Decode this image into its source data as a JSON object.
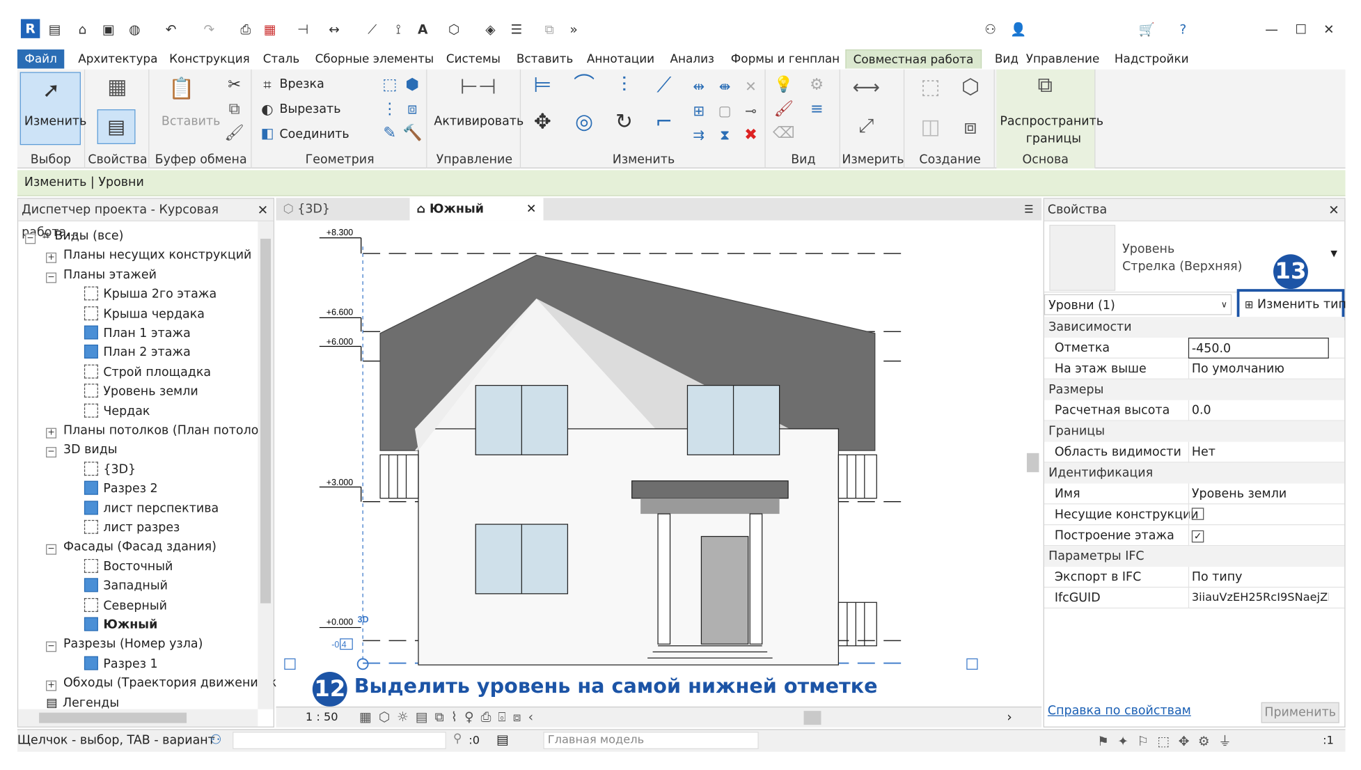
{
  "qat": {
    "app_icon": "R",
    "icons": [
      "file-icon",
      "open-icon",
      "save-icon",
      "sync-icon",
      "undo-icon",
      "redo-icon",
      "print-icon",
      "pdf-icon",
      "align-icon",
      "dimension-icon",
      "measure-icon",
      "tag-icon",
      "text-icon",
      "3d-view-icon",
      "section-icon",
      "thin-lines-icon",
      "close-hidden-icon",
      "switch-windows-icon"
    ],
    "right_icons": [
      "binoculars-icon",
      "user-icon",
      "cart-icon",
      "help-icon"
    ]
  },
  "menu": {
    "tabs": [
      "Файл",
      "Архитектура",
      "Конструкция",
      "Сталь",
      "Сборные элементы",
      "Системы",
      "Вставить",
      "Аннотации",
      "Анализ",
      "Формы и генплан",
      "Совместная работа",
      "Вид",
      "Управление",
      "Надстройки"
    ]
  },
  "ribbon": {
    "modify_label": "Изменить",
    "paste_label": "Вставить",
    "cut_label": "Врезка",
    "cut_out_label": "Вырезать",
    "join_label": "Соединить",
    "activate_label": "Активировать",
    "propagate_label1": "Распространить",
    "propagate_label2": "границы",
    "panels": {
      "select": "Выбор",
      "properties": "Свойства",
      "clipboard": "Буфер обмена",
      "geometry": "Геометрия",
      "control": "Управление",
      "modify": "Изменить",
      "view": "Вид",
      "measure": "Измерить",
      "create": "Создание",
      "basis": "Основа"
    }
  },
  "context_bar": "Изменить | Уровни",
  "project_browser": {
    "title": "Диспетчер проекта - Курсовая работа...",
    "items": [
      {
        "label": "Виды (все)",
        "level": 0,
        "toggle": "−",
        "icon": "views"
      },
      {
        "label": "Планы несущих конструкций",
        "level": 1,
        "toggle": "+"
      },
      {
        "label": "Планы этажей",
        "level": 1,
        "toggle": "−"
      },
      {
        "label": "Крыша 2го этажа",
        "level": 2,
        "icon": "plain"
      },
      {
        "label": "Крыша чердака",
        "level": 2,
        "icon": "plain"
      },
      {
        "label": "План 1 этажа",
        "level": 2,
        "icon": "blue"
      },
      {
        "label": "План 2 этажа",
        "level": 2,
        "icon": "blue"
      },
      {
        "label": "Строй площадка",
        "level": 2,
        "icon": "plain"
      },
      {
        "label": "Уровень земли",
        "level": 2,
        "icon": "plain"
      },
      {
        "label": "Чердак",
        "level": 2,
        "icon": "plain"
      },
      {
        "label": "Планы потолков (План потолочн",
        "level": 1,
        "toggle": "+"
      },
      {
        "label": "3D виды",
        "level": 1,
        "toggle": "−"
      },
      {
        "label": "{3D}",
        "level": 2,
        "icon": "plain"
      },
      {
        "label": "Разрез 2",
        "level": 2,
        "icon": "blue"
      },
      {
        "label": "лист перспектива",
        "level": 2,
        "icon": "blue"
      },
      {
        "label": "лист разрез",
        "level": 2,
        "icon": "plain"
      },
      {
        "label": "Фасады (Фасад здания)",
        "level": 1,
        "toggle": "−"
      },
      {
        "label": "Восточный",
        "level": 2,
        "icon": "plain"
      },
      {
        "label": "Западный",
        "level": 2,
        "icon": "blue"
      },
      {
        "label": "Северный",
        "level": 2,
        "icon": "plain"
      },
      {
        "label": "Южный",
        "level": 2,
        "icon": "blue",
        "bold": true
      },
      {
        "label": "Разрезы (Номер узла)",
        "level": 1,
        "toggle": "−"
      },
      {
        "label": "Разрез 1",
        "level": 2,
        "icon": "blue"
      },
      {
        "label": "Обходы (Траектория движения ка",
        "level": 1,
        "toggle": "+"
      },
      {
        "label": "Легенды",
        "level": 1,
        "icon": "legend"
      }
    ]
  },
  "view_tabs": {
    "tab1": "{3D}",
    "tab2": "Южный"
  },
  "drawing": {
    "levels": [
      "+8.300",
      "+6.600",
      "+6.000",
      "+3.000",
      "+0.000",
      "-0.4"
    ],
    "marker_3d": "3D",
    "scale": "1 : 50"
  },
  "annotations": {
    "step12_num": "12",
    "step12_text": "Выделить уровень на самой нижней отметке",
    "step13_num": "13"
  },
  "properties": {
    "title": "Свойства",
    "type_line1": "Уровень",
    "type_line2": "Стрелка (Верхняя)",
    "selector": "Уровни (1)",
    "edit_type": "Изменить тип",
    "cat_constraints": "Зависимости",
    "elevation_label": "Отметка",
    "elevation_value": "-450.0",
    "story_above_label": "На этаж выше",
    "story_above_value": "По умолчанию",
    "cat_dimensions": "Размеры",
    "comp_height_label": "Расчетная высота",
    "comp_height_value": "0.0",
    "cat_extents": "Границы",
    "scope_box_label": "Область видимости",
    "scope_box_value": "Нет",
    "cat_identity": "Идентификация",
    "name_label": "Имя",
    "name_value": "Уровень земли",
    "structural_label": "Несущие конструкции",
    "building_story_label": "Построение этажа",
    "cat_ifc": "Параметры IFC",
    "ifc_export_label": "Экспорт в IFC",
    "ifc_export_value": "По типу",
    "ifc_guid_label": "IfcGUID",
    "ifc_guid_value": "3iiauVzEH25RcI9SNaejZh",
    "help_link": "Справка по свойствам",
    "apply": "Применить"
  },
  "status": {
    "hint": "Щелчок - выбор, TAB - вариант",
    "workset_count": ":0",
    "model": "Главная модель",
    "filter_count": ":1"
  }
}
